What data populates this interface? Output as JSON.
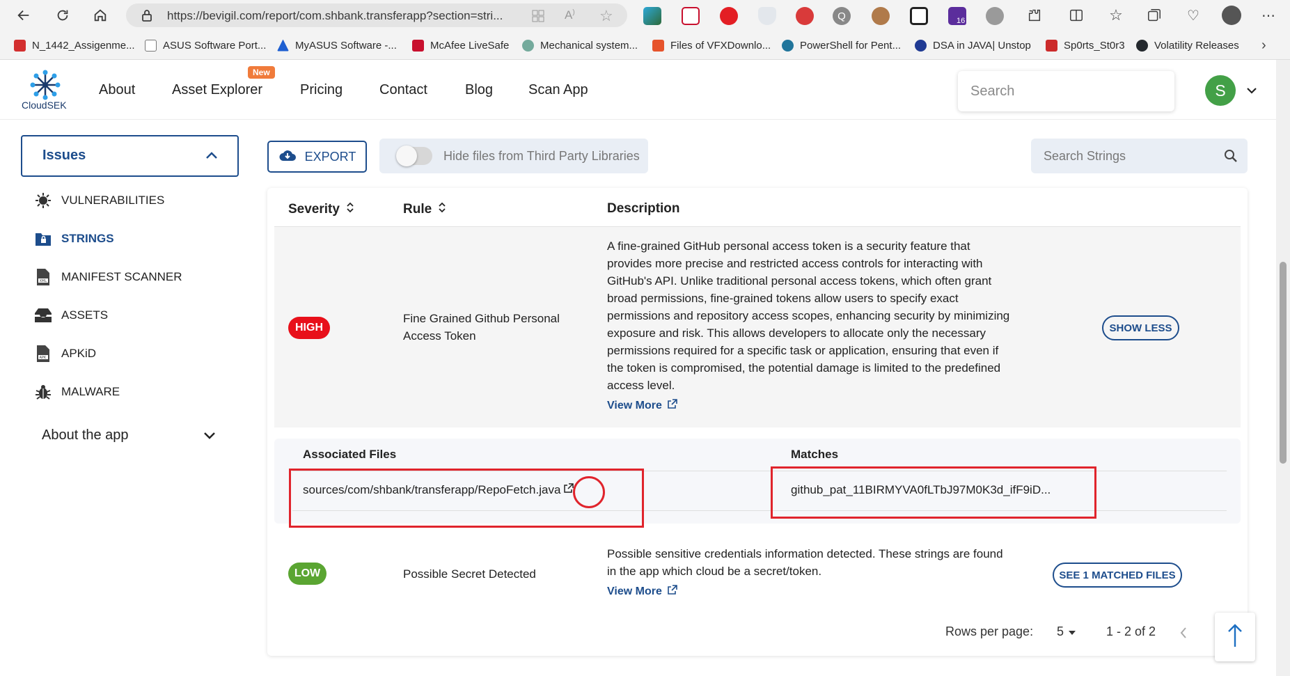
{
  "browser": {
    "url": "https://bevigil.com/report/com.shbank.transferapp?section=stri...",
    "extension_badge_count": "16",
    "bookmarks": [
      {
        "label": "N_1442_Assigenme...",
        "icon": "pdf-icon",
        "color": "#d32f2f"
      },
      {
        "label": "ASUS Software Port...",
        "icon": "page-icon",
        "color": "#777777"
      },
      {
        "label": "MyASUS Software -...",
        "icon": "asus-icon",
        "color": "#1e5fd1"
      },
      {
        "label": "McAfee LiveSafe",
        "icon": "mcafee-icon",
        "color": "#c8102e"
      },
      {
        "label": "Mechanical system...",
        "icon": "chatgpt-icon",
        "color": "#74aa9c"
      },
      {
        "label": "Files of VFXDownlo...",
        "icon": "vfx-icon",
        "color": "#e6532b"
      },
      {
        "label": "PowerShell for Pent...",
        "icon": "wordpress-icon",
        "color": "#21759b"
      },
      {
        "label": "DSA in JAVA| Unstop",
        "icon": "unstop-icon",
        "color": "#1f3a93"
      },
      {
        "label": "Sp0rts_St0r3",
        "icon": "sports-icon",
        "color": "#cc2b2b"
      },
      {
        "label": "Volatility Releases",
        "icon": "github-icon",
        "color": "#24292e"
      }
    ]
  },
  "header": {
    "logo_text": "CloudSEK",
    "nav": [
      "About",
      "Asset Explorer",
      "Pricing",
      "Contact",
      "Blog",
      "Scan App"
    ],
    "new_badge": "New",
    "search_placeholder": "Search",
    "avatar_letter": "S",
    "avatar_color": "#43a047"
  },
  "sidebar": {
    "section_label": "Issues",
    "items": [
      {
        "label": "VULNERABILITIES",
        "icon": "virus-icon",
        "active": false
      },
      {
        "label": "STRINGS",
        "icon": "folder-lock-icon",
        "active": true
      },
      {
        "label": "MANIFEST SCANNER",
        "icon": "xml-file-icon",
        "active": false
      },
      {
        "label": "ASSETS",
        "icon": "inbox-icon",
        "active": false
      },
      {
        "label": "APKiD",
        "icon": "apk-file-icon",
        "active": false
      },
      {
        "label": "MALWARE",
        "icon": "bug-icon",
        "active": false
      }
    ],
    "about_label": "About the app"
  },
  "toolbar": {
    "export_label": "EXPORT",
    "toggle_label": "Hide files from Third Party Libraries",
    "toggle_on": false,
    "strings_search_placeholder": "Search Strings"
  },
  "table": {
    "columns": [
      "Severity",
      "Rule",
      "Description"
    ],
    "rows": [
      {
        "severity": "HIGH",
        "severity_color": "#e8101a",
        "rule_lines": [
          "Fine Grained Github Personal",
          "Access Token"
        ],
        "description_lines": [
          "A fine-grained GitHub personal access token is a security feature that",
          "provides more precise and restricted access controls for interacting with",
          "GitHub's API. Unlike traditional personal access tokens, which often grant",
          "broad permissions, fine-grained tokens allow users to specify exact",
          "permissions and repository access scopes, enhancing security by minimizing",
          "exposure and risk. This allows developers to allocate only the necessary",
          "permissions required for a specific task or application, ensuring that even if",
          "the token is compromised, the potential damage is limited to the predefined",
          "access level."
        ],
        "view_more": "View More",
        "action_label": "SHOW LESS",
        "associated_files_header": "Associated Files",
        "matches_header": "Matches",
        "file": "sources/com/shbank/transferapp/RepoFetch.java",
        "match": "github_pat_11BIRMYVA0fLTbJ97M0K3d_ifF9iD..."
      },
      {
        "severity": "LOW",
        "severity_color": "#5aa532",
        "rule_lines": [
          "Possible Secret Detected"
        ],
        "description_lines": [
          "Possible sensitive credentials information detected. These strings are found",
          "in the app which cloud be a secret/token."
        ],
        "view_more": "View More",
        "action_label": "SEE 1 MATCHED FILES"
      }
    ],
    "pagination": {
      "rows_per_page_label": "Rows per page:",
      "rows_per_page": "5",
      "range": "1 - 2 of 2"
    }
  },
  "annotations": {
    "highlight_color": "#e0242c"
  }
}
